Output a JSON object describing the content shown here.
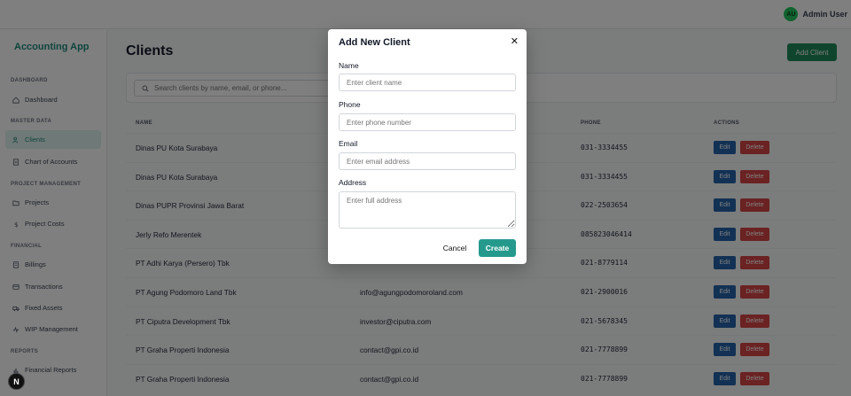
{
  "header": {
    "avatar_initials": "AU",
    "user_name": "Admin User"
  },
  "sidebar": {
    "brand": "Accounting App",
    "sections": {
      "dashboard": "DASHBOARD",
      "master": "MASTER DATA",
      "project": "PROJECT MANAGEMENT",
      "financial": "FINANCIAL",
      "reports": "REPORTS"
    },
    "items": {
      "dashboard": "Dashboard",
      "clients": "Clients",
      "coa": "Chart of Accounts",
      "projects": "Projects",
      "project_costs": "Project Costs",
      "billings": "Billings",
      "transactions": "Transactions",
      "fixed_assets": "Fixed Assets",
      "wip": "WIP Management",
      "financial_reports": "Financial Reports"
    },
    "fab_label": "N"
  },
  "main": {
    "title": "Clients",
    "add_button": "Add Client",
    "search_placeholder": "Search clients by name, email, or phone...",
    "columns": {
      "name": "NAME",
      "phone": "PHONE",
      "actions": "ACTIONS"
    },
    "edit_label": "Edit",
    "delete_label": "Delete",
    "rows": [
      {
        "name": "Dinas PU Kota Surabaya",
        "email": "",
        "phone": "031-3334455"
      },
      {
        "name": "Dinas PU Kota Surabaya",
        "email": "",
        "phone": "031-3334455"
      },
      {
        "name": "Dinas PUPR Provinsi Jawa Barat",
        "email": "",
        "phone": "022-2503654"
      },
      {
        "name": "Jerly Refo Merentek",
        "email": "",
        "phone": "085823046414"
      },
      {
        "name": "PT Adhi Karya (Persero) Tbk",
        "email": "",
        "phone": "021-8779114"
      },
      {
        "name": "PT Agung Podomoro Land Tbk",
        "email": "info@agungpodomoroland.com",
        "phone": "021-2900016"
      },
      {
        "name": "PT Ciputra Development Tbk",
        "email": "investor@ciputra.com",
        "phone": "021-5678345"
      },
      {
        "name": "PT Graha Properti Indonesia",
        "email": "contact@gpi.co.id",
        "phone": "021-7778899"
      },
      {
        "name": "PT Graha Properti Indonesia",
        "email": "contact@gpi.co.id",
        "phone": "021-7778899"
      }
    ]
  },
  "modal": {
    "title": "Add New Client",
    "close_glyph": "✕",
    "fields": {
      "name_label": "Name",
      "name_placeholder": "Enter client name",
      "phone_label": "Phone",
      "phone_placeholder": "Enter phone number",
      "email_label": "Email",
      "email_placeholder": "Enter email address",
      "address_label": "Address",
      "address_placeholder": "Enter full address"
    },
    "cancel": "Cancel",
    "create": "Create"
  },
  "colors": {
    "accent": "#1f8a7d",
    "primary_button": "#1f8a5a",
    "edit": "#2563a8",
    "delete": "#d64545"
  }
}
